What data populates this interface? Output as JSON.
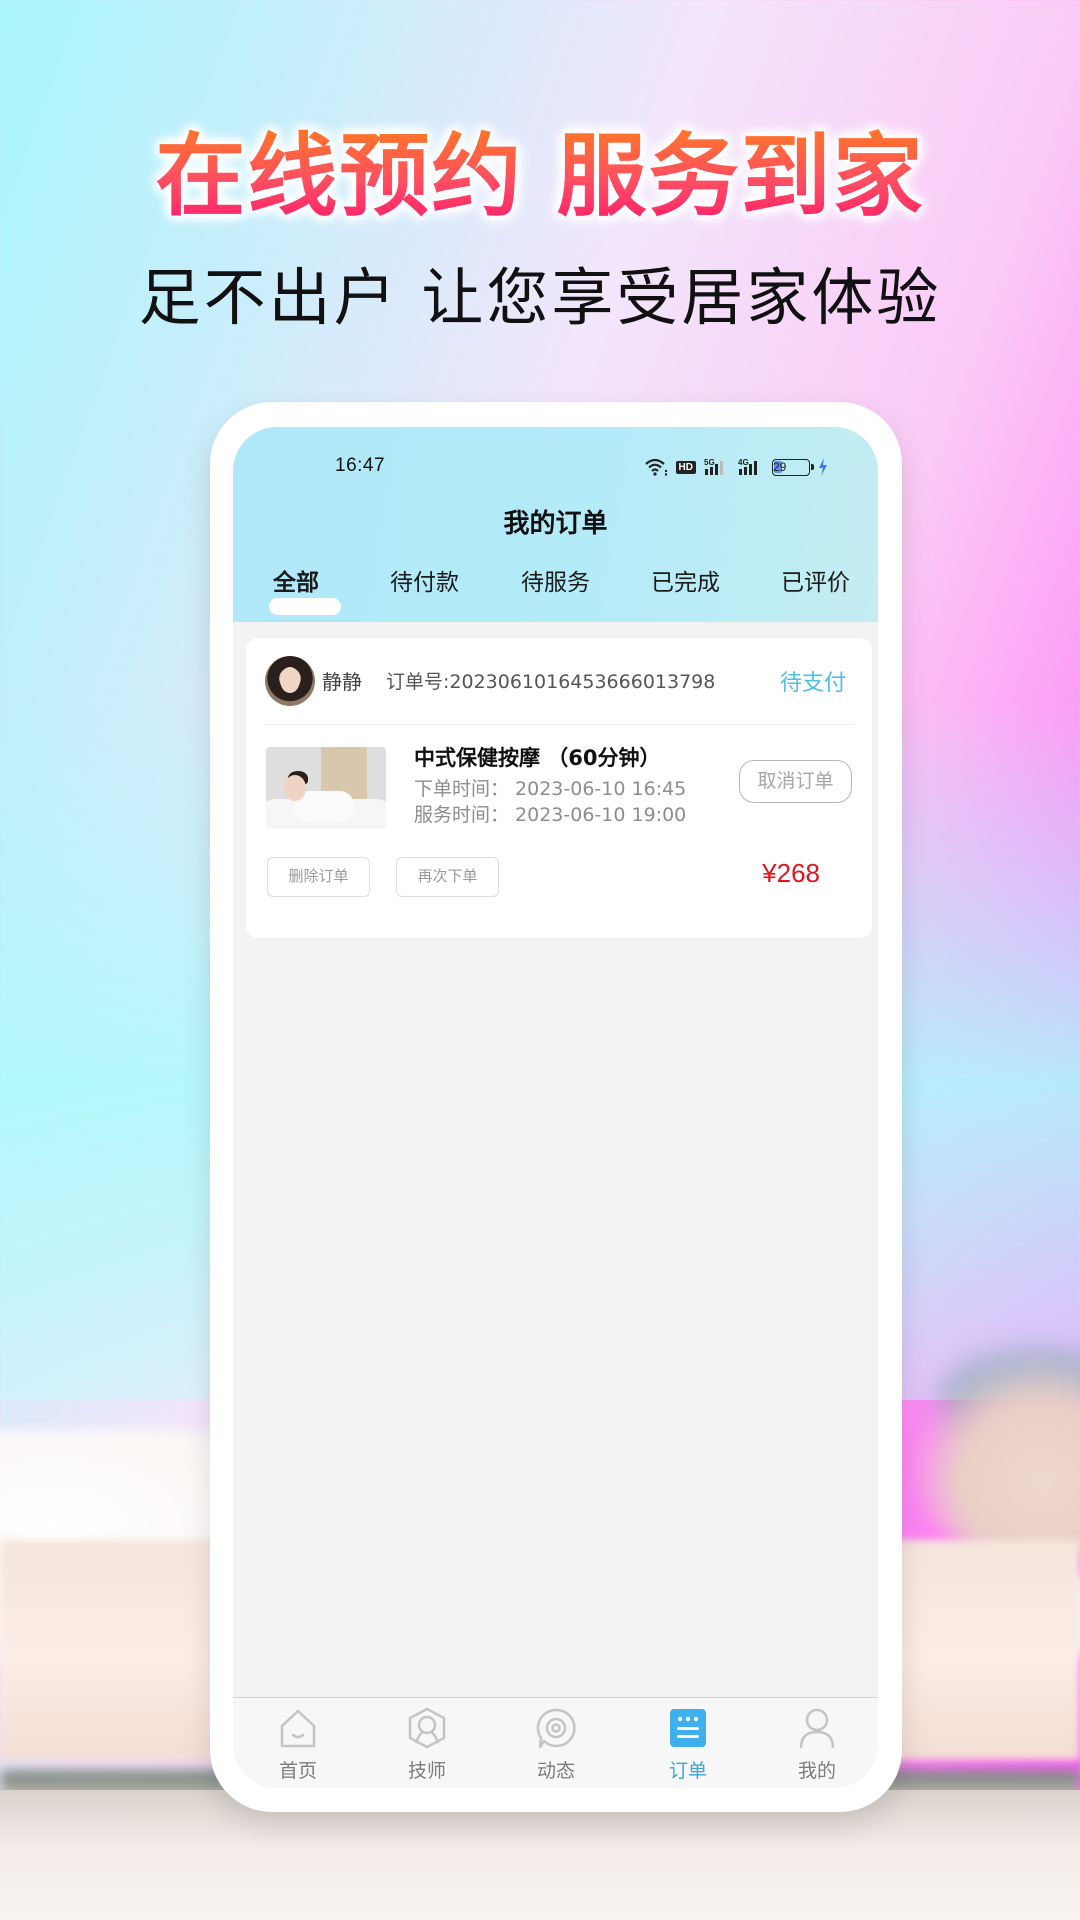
{
  "promo": {
    "headline": "在线预约 服务到家",
    "subheadline": "足不出户 让您享受居家体验"
  },
  "status_bar": {
    "time": "16:47",
    "network_badges": [
      "HD",
      "5G",
      "4G"
    ],
    "battery_level": "29",
    "charging": true
  },
  "header": {
    "title": "我的订单"
  },
  "tabs": [
    {
      "label": "全部",
      "active": true
    },
    {
      "label": "待付款",
      "active": false
    },
    {
      "label": "待服务",
      "active": false
    },
    {
      "label": "已完成",
      "active": false
    },
    {
      "label": "已评价",
      "active": false
    }
  ],
  "orders": [
    {
      "username": "静静",
      "order_no": "订单号:20230610164536660137 98",
      "order_no_text": "订单号:2023061016453666013798",
      "status": "待支付",
      "service_title": "中式保健按摩 （60分钟）",
      "order_time": "下单时间：  2023-06-10 16:45",
      "service_time": "服务时间：  2023-06-10 19:00",
      "cancel_label": "取消订单",
      "delete_label": "删除订单",
      "reorder_label": "再次下单",
      "price": "¥268"
    }
  ],
  "tabbar": [
    {
      "label": "首页",
      "icon": "home-icon",
      "active": false
    },
    {
      "label": "技师",
      "icon": "technician-icon",
      "active": false
    },
    {
      "label": "动态",
      "icon": "feed-icon",
      "active": false
    },
    {
      "label": "订单",
      "icon": "orders-icon",
      "active": true
    },
    {
      "label": "我的",
      "icon": "profile-icon",
      "active": false
    }
  ],
  "colors": {
    "accent": "#3aa3e0",
    "status_pending": "#4ec0e3",
    "price": "#e5141b",
    "header_bg": "#b0e8f9"
  }
}
